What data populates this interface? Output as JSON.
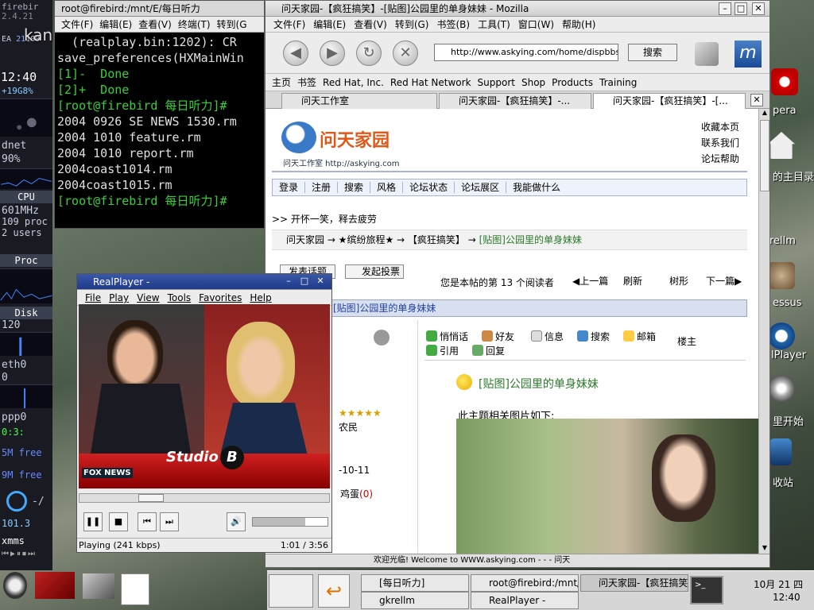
{
  "gkrellm": {
    "host": "firebir",
    "version": "2.4.21",
    "ea_label": "EA",
    "ea_val1": "21",
    "ea_val2": "100",
    "time": "12:40",
    "t2": "07",
    "temp": "+19",
    "temp2": "G8%",
    "net": "dnet",
    "netpct": "90%",
    "cpu": "CPU",
    "mhz": "601MHz",
    "procs": "109 proc",
    "users": "2 users",
    "proc": "Proc",
    "disk": "Disk",
    "diskval": "120",
    "eth0": "eth0",
    "eth0val": "0",
    "ppp0": "ppp0",
    "ppp0val": "0:3:",
    "mem1": "5M free",
    "mem2": "9M free",
    "rfa": "-/",
    "rfaval": "101.3",
    "xmms": "xmms"
  },
  "watermark": "kankanu.com",
  "terminal": {
    "title": "root@firebird:/mnt/E/每日听力",
    "menu": [
      "文件(F)",
      "编辑(E)",
      "查看(V)",
      "终端(T)",
      "转到(G"
    ],
    "lines": [
      "  (realplay.bin:1202): CR",
      "save_preferences(HXMainWin",
      "",
      "[1]-  Done",
      "[2]+  Done",
      "[root@firebird 每日听力]#",
      "2004 0926 SE NEWS 1530.rm",
      "2004 1010 feature.rm",
      "2004 1010 report.rm",
      "2004coast1014.rm",
      "2004coast1015.rm",
      "[root@firebird 每日听力]#"
    ]
  },
  "mozilla": {
    "title": "问天家园-【疯狂搞笑】-[贴图]公园里的单身妹妹 - Mozilla",
    "menu": [
      "文件(F)",
      "编辑(E)",
      "查看(V)",
      "转到(G)",
      "书签(B)",
      "工具(T)",
      "窗口(W)",
      "帮助(H)"
    ],
    "url": "http://www.askying.com/home/dispbbs.",
    "search": "搜索",
    "bookmarks": [
      "主页",
      "书签",
      "Red Hat, Inc.",
      "Red Hat Network",
      "Support",
      "Shop",
      "Products",
      "Training"
    ],
    "tabs": [
      "问天工作室",
      "问天家园-【疯狂搞笑】-...",
      "问天家园-【疯狂搞笑】-[..."
    ],
    "status": "欢迎光临! Welcome to WWW.askying.com - - - 问天"
  },
  "page": {
    "logo": "问天家园",
    "logo_sub": "问天工作室  http://askying.com",
    "top_links": [
      "收藏本页",
      "联系我们",
      "论坛帮助"
    ],
    "nav": [
      "登录",
      "注册",
      "搜索",
      "风格",
      "论坛状态",
      "论坛展区",
      "我能做什么"
    ],
    "motto": ">> 开怀一笑，释去疲劳",
    "breadcrumb": "问天家园 → ★缤纷旅程★ → 【疯狂搞笑】 → ",
    "crumb_current": "[贴图]公园里的单身妹妹",
    "new_topic": "发表话题",
    "new_poll": "发起投票",
    "readers": "您是本帖的第 13 个阅读者",
    "prev": "上一篇",
    "refresh": "刷新",
    "tree": "树形",
    "next": "下一篇",
    "forum_title": "[贴图]公园里的单身妹妹",
    "actions": [
      "悄悄话",
      "好友",
      "信息",
      "搜索",
      "邮箱",
      "引用",
      "回复"
    ],
    "floor": "楼主",
    "post_title": "[贴图]公园里的单身妹妹",
    "post_text": "此主题相关图片如下:",
    "user_rank": "农民",
    "user_date": "-10-11",
    "egg": "鸡蛋",
    "egg_count": "(0)"
  },
  "realplayer": {
    "title": "RealPlayer -",
    "menu": [
      "File",
      "Play",
      "View",
      "Tools",
      "Favorites",
      "Help"
    ],
    "brand1": "Studio",
    "brand2": "B",
    "fox": "FOX NEWS",
    "status": "Playing (241 kbps)",
    "time": "1:01 / 3:56"
  },
  "desktop": {
    "icons": [
      "pera",
      "的主目录",
      "rellm",
      "essus",
      "lPlayer",
      "里开始",
      "收站"
    ]
  },
  "taskbar": {
    "tasks": [
      "[每日听力]",
      "gkrellm",
      "root@firebird:/mnt/E/每",
      "RealPlayer -",
      "问天家园-【疯狂搞笑"
    ],
    "clock_date": "10月 21 四",
    "clock_time": "12:40"
  }
}
